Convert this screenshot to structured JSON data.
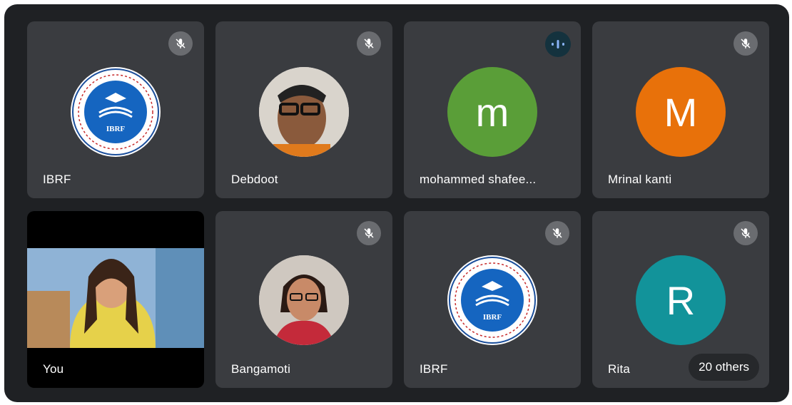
{
  "colors": {
    "background": "#1f2124",
    "tile": "#3a3c40",
    "speaking_indicator": "#8ab4f8",
    "avatar_m_green": "#5a9e38",
    "avatar_M_orange": "#e8710a",
    "avatar_R_teal": "#12939a"
  },
  "participants": [
    {
      "name": "IBRF",
      "avatar": "ibrf-logo",
      "status": "muted"
    },
    {
      "name": "Debdoot",
      "avatar": "photo",
      "status": "muted"
    },
    {
      "name": "mohammed shafee...",
      "avatar_letter": "m",
      "status": "speaking"
    },
    {
      "name": "Mrinal kanti",
      "avatar_letter": "M",
      "status": "muted"
    },
    {
      "name": "You",
      "avatar": "video",
      "status": "video-on"
    },
    {
      "name": "Bangamoti",
      "avatar": "photo",
      "status": "muted"
    },
    {
      "name": "IBRF",
      "avatar": "ibrf-logo",
      "status": "muted"
    },
    {
      "name": "Rita",
      "avatar_letter": "R",
      "status": "muted"
    }
  ],
  "logo_text": "IBRF",
  "others_label": "20 others"
}
